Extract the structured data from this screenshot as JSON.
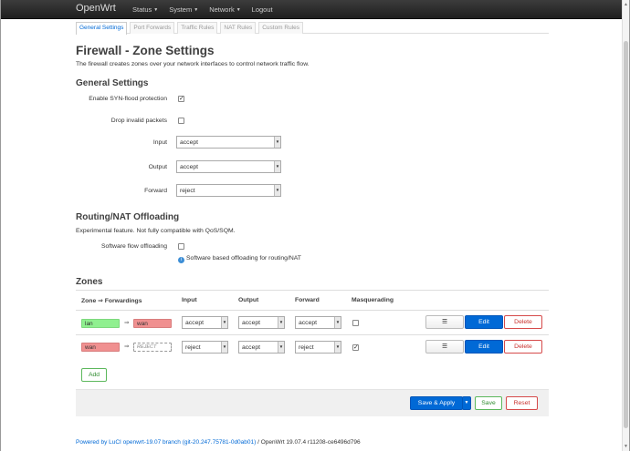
{
  "nav": {
    "brand": "OpenWrt",
    "menus": [
      "Status",
      "System",
      "Network",
      "Logout"
    ]
  },
  "tabs": [
    "General Settings",
    "Port Forwards",
    "Traffic Rules",
    "NAT Rules",
    "Custom Rules"
  ],
  "page": {
    "title": "Firewall - Zone Settings",
    "description": "The firewall creates zones over your network interfaces to control network traffic flow."
  },
  "general": {
    "heading": "General Settings",
    "syn_flood_label": "Enable SYN-flood protection",
    "syn_flood_checked": true,
    "drop_invalid_label": "Drop invalid packets",
    "drop_invalid_checked": false,
    "input_label": "Input",
    "input_value": "accept",
    "output_label": "Output",
    "output_value": "accept",
    "forward_label": "Forward",
    "forward_value": "reject"
  },
  "offload": {
    "heading": "Routing/NAT Offloading",
    "description": "Experimental feature. Not fully compatible with QoS/SQM.",
    "sw_flow_label": "Software flow offloading",
    "sw_flow_checked": false,
    "hint": "Software based offloading for routing/NAT"
  },
  "zones": {
    "heading": "Zones",
    "columns": [
      "Zone ⇒ Forwardings",
      "Input",
      "Output",
      "Forward",
      "Masquerading"
    ],
    "rows": [
      {
        "zone": "lan",
        "arrow": "⇒",
        "dest": "wan",
        "input": "accept",
        "output": "accept",
        "forward": "accept",
        "masq": false
      },
      {
        "zone": "wan",
        "arrow": "⇒",
        "dest": "REJECT",
        "input": "reject",
        "output": "accept",
        "forward": "reject",
        "masq": true
      }
    ],
    "btn_reorder": "☰",
    "btn_edit": "Edit",
    "btn_delete": "Delete",
    "btn_add": "Add"
  },
  "actions": {
    "save_apply": "Save & Apply",
    "save": "Save",
    "reset": "Reset"
  },
  "footer": {
    "link": "Powered by LuCI openwrt-19.07 branch (git-20.247.75781-0d0ab01)",
    "version": " / OpenWrt 19.07.4 r11208-ce6496d796"
  },
  "colors": {
    "navbar": "#1f1f1f",
    "primary": "#0069d6",
    "lan_zone": "#90f090",
    "wan_zone": "#f09090"
  }
}
